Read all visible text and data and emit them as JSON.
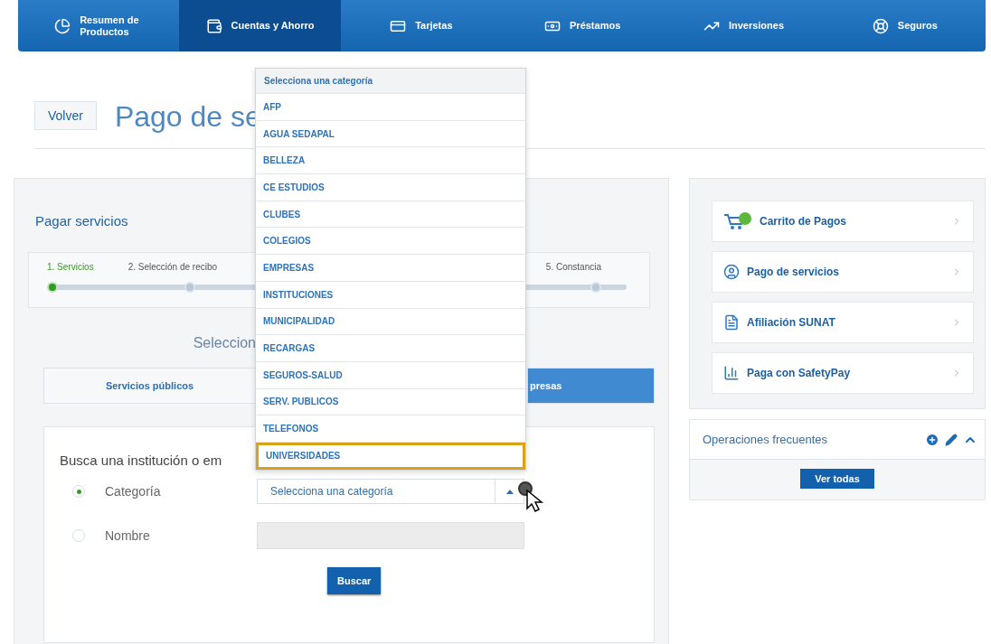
{
  "nav": {
    "items": [
      {
        "label": "Resumen de Productos",
        "selected": false
      },
      {
        "label": "Cuentas y Ahorro",
        "selected": true
      },
      {
        "label": "Tarjetas",
        "selected": false
      },
      {
        "label": "Préstamos",
        "selected": false
      },
      {
        "label": "Inversiones",
        "selected": false
      },
      {
        "label": "Seguros",
        "selected": false
      }
    ]
  },
  "header": {
    "back_button": "Volver",
    "title": "Pago de se"
  },
  "pay_panel": {
    "title": "Pagar servicios",
    "steps": [
      {
        "label": "1. Servicios",
        "done": true
      },
      {
        "label": "2. Selección de recibo",
        "done": false
      },
      {
        "label": "5. Constancia",
        "done": false
      }
    ],
    "subtitle": "Seleccion",
    "tabs": [
      {
        "label": "Servicios públicos",
        "selected": false
      },
      {
        "label": "presas",
        "selected": true
      }
    ],
    "search": {
      "title": "Busca una institución o em",
      "options": [
        {
          "label": "Categoría",
          "selected": true,
          "kind": "select",
          "value": "Selecciona una categoría"
        },
        {
          "label": "Nombre",
          "selected": false,
          "kind": "text"
        }
      ],
      "button": "Buscar"
    }
  },
  "dropdown": {
    "header": "Selecciona una categoría",
    "items": [
      {
        "label": "AFP",
        "selected": false
      },
      {
        "label": "AGUA SEDAPAL",
        "selected": false
      },
      {
        "label": "BELLEZA",
        "selected": false
      },
      {
        "label": "CE ESTUDIOS",
        "selected": false
      },
      {
        "label": "CLUBES",
        "selected": false
      },
      {
        "label": "COLEGIOS",
        "selected": false
      },
      {
        "label": "EMPRESAS",
        "selected": false
      },
      {
        "label": "INSTITUCIONES",
        "selected": false
      },
      {
        "label": "MUNICIPALIDAD",
        "selected": false
      },
      {
        "label": "RECARGAS",
        "selected": false
      },
      {
        "label": "SEGUROS-SALUD",
        "selected": false
      },
      {
        "label": "SERV. PUBLICOS",
        "selected": false
      },
      {
        "label": "TELEFONOS",
        "selected": false
      },
      {
        "label": "UNIVERSIDADES",
        "selected": true
      }
    ]
  },
  "shortcuts": [
    {
      "label": "Carrito de Pagos"
    },
    {
      "label": "Pago de servicios"
    },
    {
      "label": "Afiliación SUNAT"
    },
    {
      "label": "Paga con SafetyPay"
    }
  ],
  "frequent": {
    "title": "Operaciones frecuentes",
    "button": "Ver todas"
  }
}
